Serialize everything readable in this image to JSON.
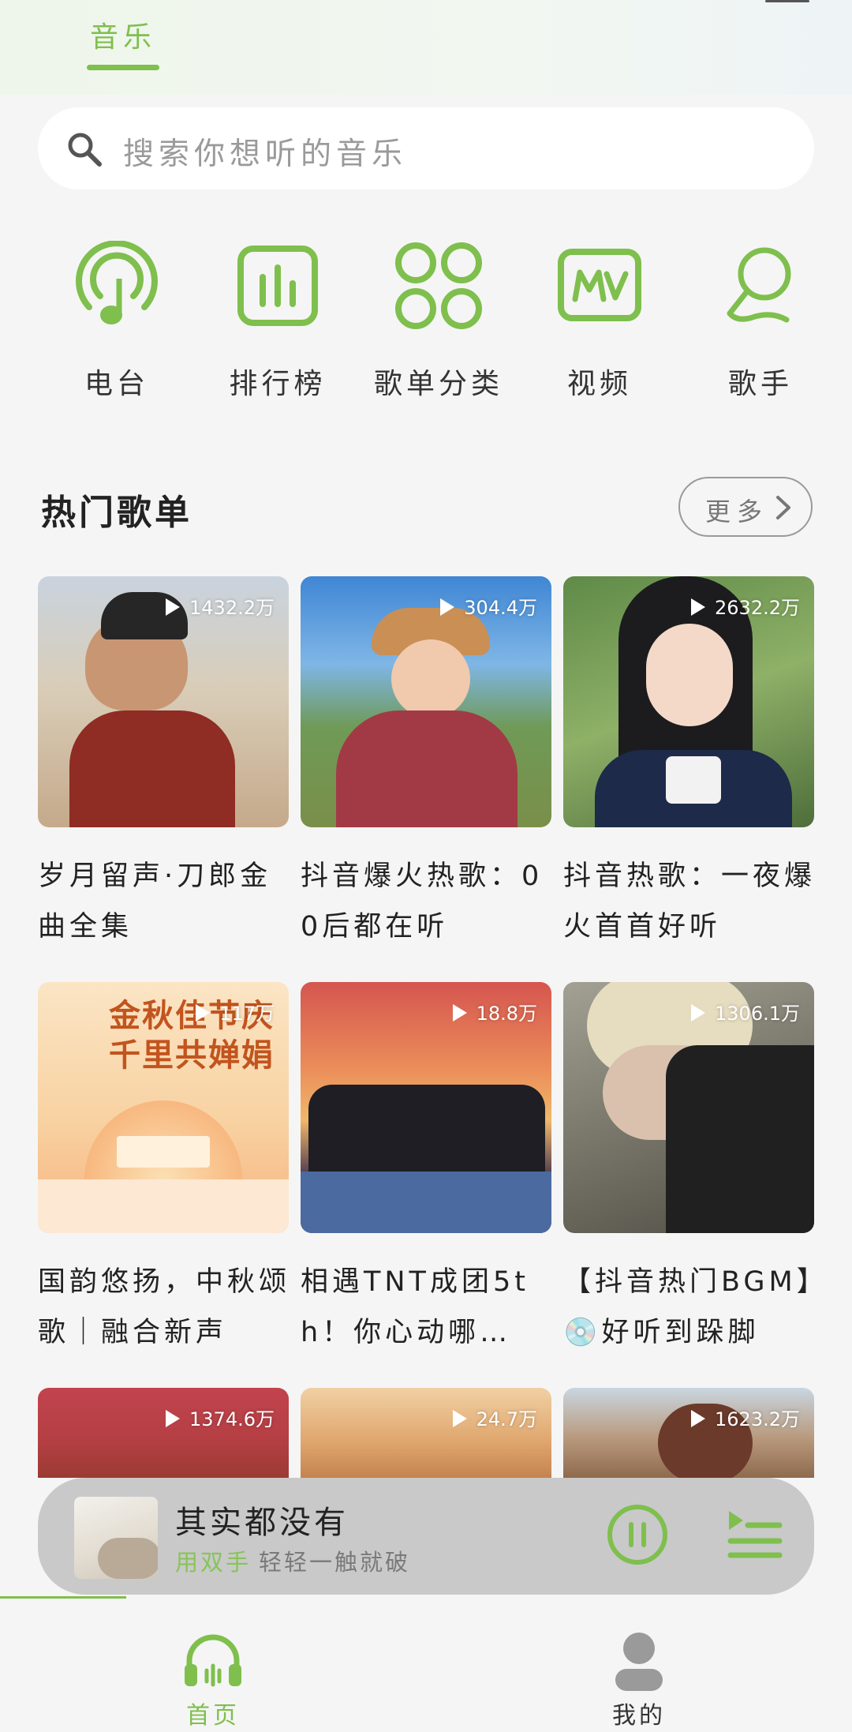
{
  "header": {
    "active_tab": "音乐"
  },
  "search": {
    "placeholder": "搜索你想听的音乐"
  },
  "categories": [
    {
      "label": "电台",
      "icon": "radio-icon"
    },
    {
      "label": "排行榜",
      "icon": "chart-icon"
    },
    {
      "label": "歌单分类",
      "icon": "grid-icon"
    },
    {
      "label": "视频",
      "icon": "mv-icon"
    },
    {
      "label": "歌手",
      "icon": "singer-icon"
    }
  ],
  "hot_playlists": {
    "title": "热门歌单",
    "more_label": "更多",
    "items": [
      {
        "title": "岁月留声·刀郎金曲全集",
        "plays": "1432.2万"
      },
      {
        "title": "抖音爆火热歌：00后都在听",
        "plays": "304.4万"
      },
      {
        "title": "抖音热歌：一夜爆火首首好听",
        "plays": "2632.2万"
      },
      {
        "title": "国韵悠扬，中秋颂歌｜融合新声",
        "plays": "117万",
        "cover_text_1": "金秋佳节庆",
        "cover_text_2": "千里共婵娟"
      },
      {
        "title": "相遇TNT成团5th！你心动哪…",
        "plays": "18.8万"
      },
      {
        "title": "【抖音热门BGM】💿好听到跺脚",
        "plays": "1306.1万"
      },
      {
        "title": "",
        "plays": "1374.6万"
      },
      {
        "title": "",
        "plays": "24.7万"
      },
      {
        "title": "",
        "plays": "1623.2万"
      }
    ]
  },
  "now_playing": {
    "title": "其实都没有",
    "artist_part": "用双手",
    "lyric_part": "轻轻一触就破"
  },
  "bottom_nav": {
    "home_label": "首页",
    "mine_label": "我的"
  },
  "colors": {
    "accent": "#7fbf4d",
    "player_bg": "#c9c9c9",
    "page_bg": "#f5f5f5"
  }
}
